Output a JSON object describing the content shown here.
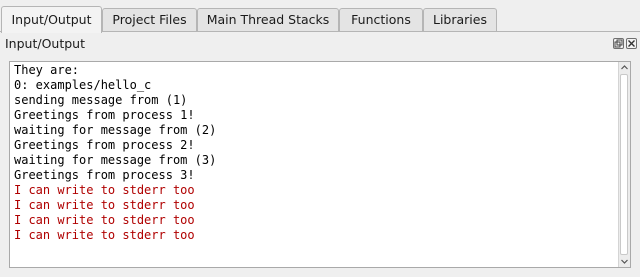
{
  "tabs": [
    {
      "label": "Input/Output",
      "active": true
    },
    {
      "label": "Project Files",
      "active": false
    },
    {
      "label": "Main Thread Stacks",
      "active": false
    },
    {
      "label": "Functions",
      "active": false
    },
    {
      "label": "Libraries",
      "active": false
    }
  ],
  "panel": {
    "title": "Input/Output",
    "float_icon": "float-window-icon",
    "close_icon": "close-icon"
  },
  "console": {
    "stderr_color": "#b00000",
    "stdout_color": "#000000",
    "lines": [
      {
        "text": "They are:",
        "stream": "stdout"
      },
      {
        "text": "0: examples/hello_c",
        "stream": "stdout"
      },
      {
        "text": "sending message from (1)",
        "stream": "stdout"
      },
      {
        "text": "Greetings from process 1!",
        "stream": "stdout"
      },
      {
        "text": "waiting for message from (2)",
        "stream": "stdout"
      },
      {
        "text": "Greetings from process 2!",
        "stream": "stdout"
      },
      {
        "text": "waiting for message from (3)",
        "stream": "stdout"
      },
      {
        "text": "Greetings from process 3!",
        "stream": "stdout"
      },
      {
        "text": "I can write to stderr too",
        "stream": "stderr"
      },
      {
        "text": "I can write to stderr too",
        "stream": "stderr"
      },
      {
        "text": "I can write to stderr too",
        "stream": "stderr"
      },
      {
        "text": "I can write to stderr too",
        "stream": "stderr"
      }
    ]
  }
}
